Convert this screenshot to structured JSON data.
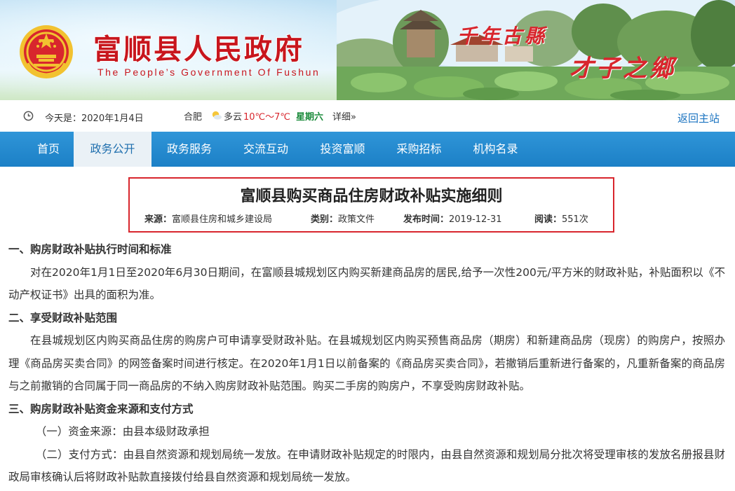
{
  "banner": {
    "title": "富顺县人民政府",
    "subtitle": "The People’s Government Of Fushun",
    "slogan_1": "千年古縣",
    "slogan_2": "才子之鄉"
  },
  "infobar": {
    "date_text": "今天是：2020年1月4日",
    "city": "合肥",
    "weather": "多云",
    "temperature": "10℃～7℃",
    "weekday": "星期六",
    "detail_link": "详细»",
    "back_link": "返回主站"
  },
  "nav": {
    "items": [
      {
        "label": "首页",
        "active": false
      },
      {
        "label": "政务公开",
        "active": true
      },
      {
        "label": "政务服务",
        "active": false
      },
      {
        "label": "交流互动",
        "active": false
      },
      {
        "label": "投资富顺",
        "active": false
      },
      {
        "label": "采购招标",
        "active": false
      },
      {
        "label": "机构名录",
        "active": false
      }
    ]
  },
  "article": {
    "title": "富顺县购买商品住房财政补贴实施细则",
    "source_label": "来源：",
    "source": "富顺县住房和城乡建设局",
    "category_label": "类别：",
    "category": "政策文件",
    "published_label": "发布时间：",
    "published": "2019-12-31",
    "reads_label": "阅读：",
    "reads": "551次",
    "sections": [
      {
        "heading": "一、购房财政补贴执行时间和标准",
        "paragraphs": [
          "对在2020年1月1日至2020年6月30日期间，在富顺县城规划区内购买新建商品房的居民,给予一次性200元/平方米的财政补贴，补贴面积以《不动产权证书》出具的面积为准。"
        ]
      },
      {
        "heading": "二、享受财政补贴范围",
        "paragraphs": [
          "在县城规划区内购买商品住房的购房户可申请享受财政补贴。在县城规划区内购买预售商品房（期房）和新建商品房（现房）的购房户，按照办理《商品房买卖合同》的网签备案时间进行核定。在2020年1月1日以前备案的《商品房买卖合同》，若撤销后重新进行备案的，凡重新备案的商品房与之前撤销的合同属于同一商品房的不纳入购房财政补贴范围。购买二手房的购房户，不享受购房财政补贴。"
        ]
      },
      {
        "heading": "三、购房财政补贴资金来源和支付方式",
        "items": [
          "（一）资金来源：由县本级财政承担",
          "（二）支付方式：由县自然资源和规划局统一发放。在申请财政补贴规定的时限内，由县自然资源和规划局分批次将受理审核的发放名册报县财政局审核确认后将财政补贴款直接拨付给县自然资源和规划局统一发放。"
        ]
      }
    ]
  },
  "icons": {
    "emblem": "national-emblem-icon",
    "clock": "clock-icon",
    "weather": "sun-cloud-icon"
  },
  "colors": {
    "brand_red": "#c8161d",
    "nav_blue": "#1c80c6",
    "link_blue": "#1a73c0",
    "weekday_green": "#1a8a3a",
    "title_border_red": "#d8262d"
  }
}
